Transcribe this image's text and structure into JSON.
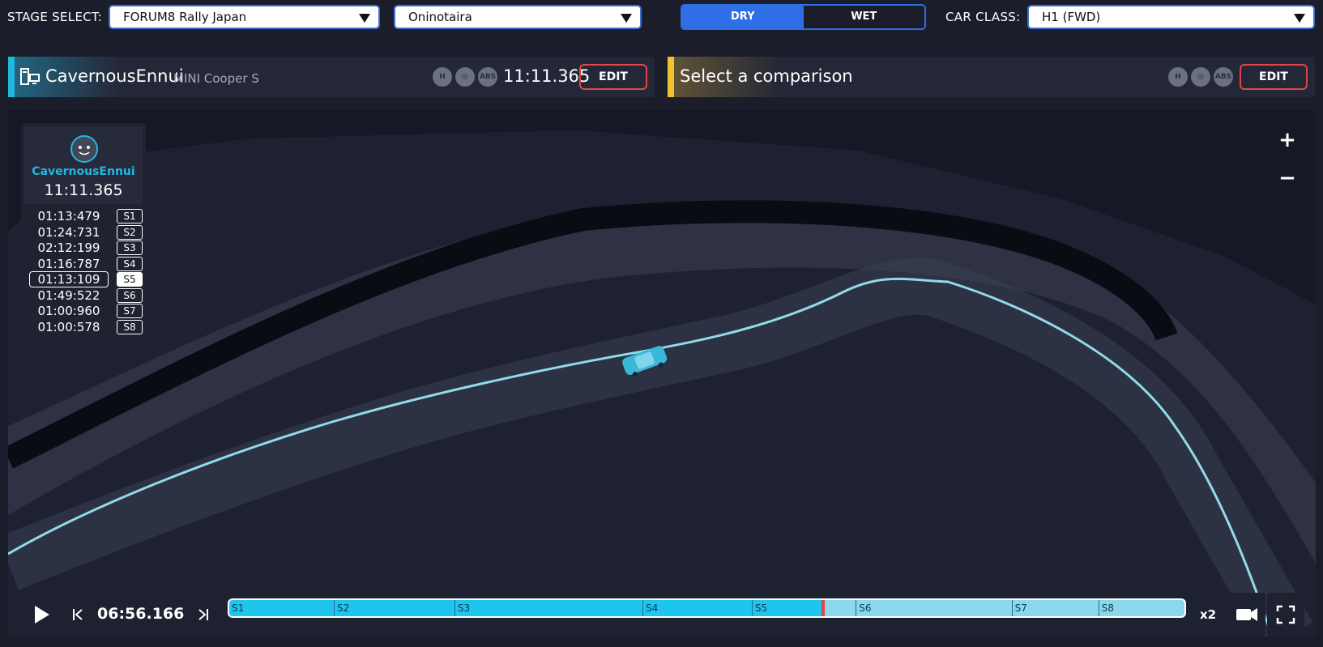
{
  "topbar": {
    "stage_label": "STAGE SELECT:",
    "rally": "FORUM8 Rally Japan",
    "stage": "Oninotaira",
    "conditions": [
      "DRY",
      "WET"
    ],
    "active_condition": "DRY",
    "car_class_label": "CAR CLASS:",
    "car_class": "H1 (FWD)"
  },
  "player": {
    "name": "CavernousEnnui",
    "car": "MINI Cooper S",
    "time": "11:11.365",
    "edit_label": "EDIT",
    "assists": [
      "H",
      "wheel",
      "ABS"
    ],
    "accent": "#20b8e0"
  },
  "comparison": {
    "placeholder": "Select a comparison",
    "edit_label": "EDIT",
    "assists": [
      "H",
      "wheel",
      "ABS"
    ],
    "accent": "#f2c230"
  },
  "driver_panel": {
    "name": "CavernousEnnui",
    "total_time": "11:11.365",
    "splits": [
      {
        "time": "01:13:479",
        "sector": "S1"
      },
      {
        "time": "01:24:731",
        "sector": "S2"
      },
      {
        "time": "02:12:199",
        "sector": "S3"
      },
      {
        "time": "01:16:787",
        "sector": "S4"
      },
      {
        "time": "01:13:109",
        "sector": "S5"
      },
      {
        "time": "01:49:522",
        "sector": "S6"
      },
      {
        "time": "01:00:960",
        "sector": "S7"
      },
      {
        "time": "01:00:578",
        "sector": "S8"
      }
    ],
    "active_sector": "S5"
  },
  "map": {
    "zoom_in": "+",
    "zoom_out": "−"
  },
  "playback": {
    "current_time": "06:56.166",
    "speed": "x2",
    "progress_fraction": 0.62,
    "sectors": [
      "S1",
      "S2",
      "S3",
      "S4",
      "S5",
      "S6",
      "S7",
      "S8"
    ],
    "colors": {
      "played": "#1ec5ee",
      "remaining": "#8ad8ec",
      "marker": "#e04646"
    }
  }
}
